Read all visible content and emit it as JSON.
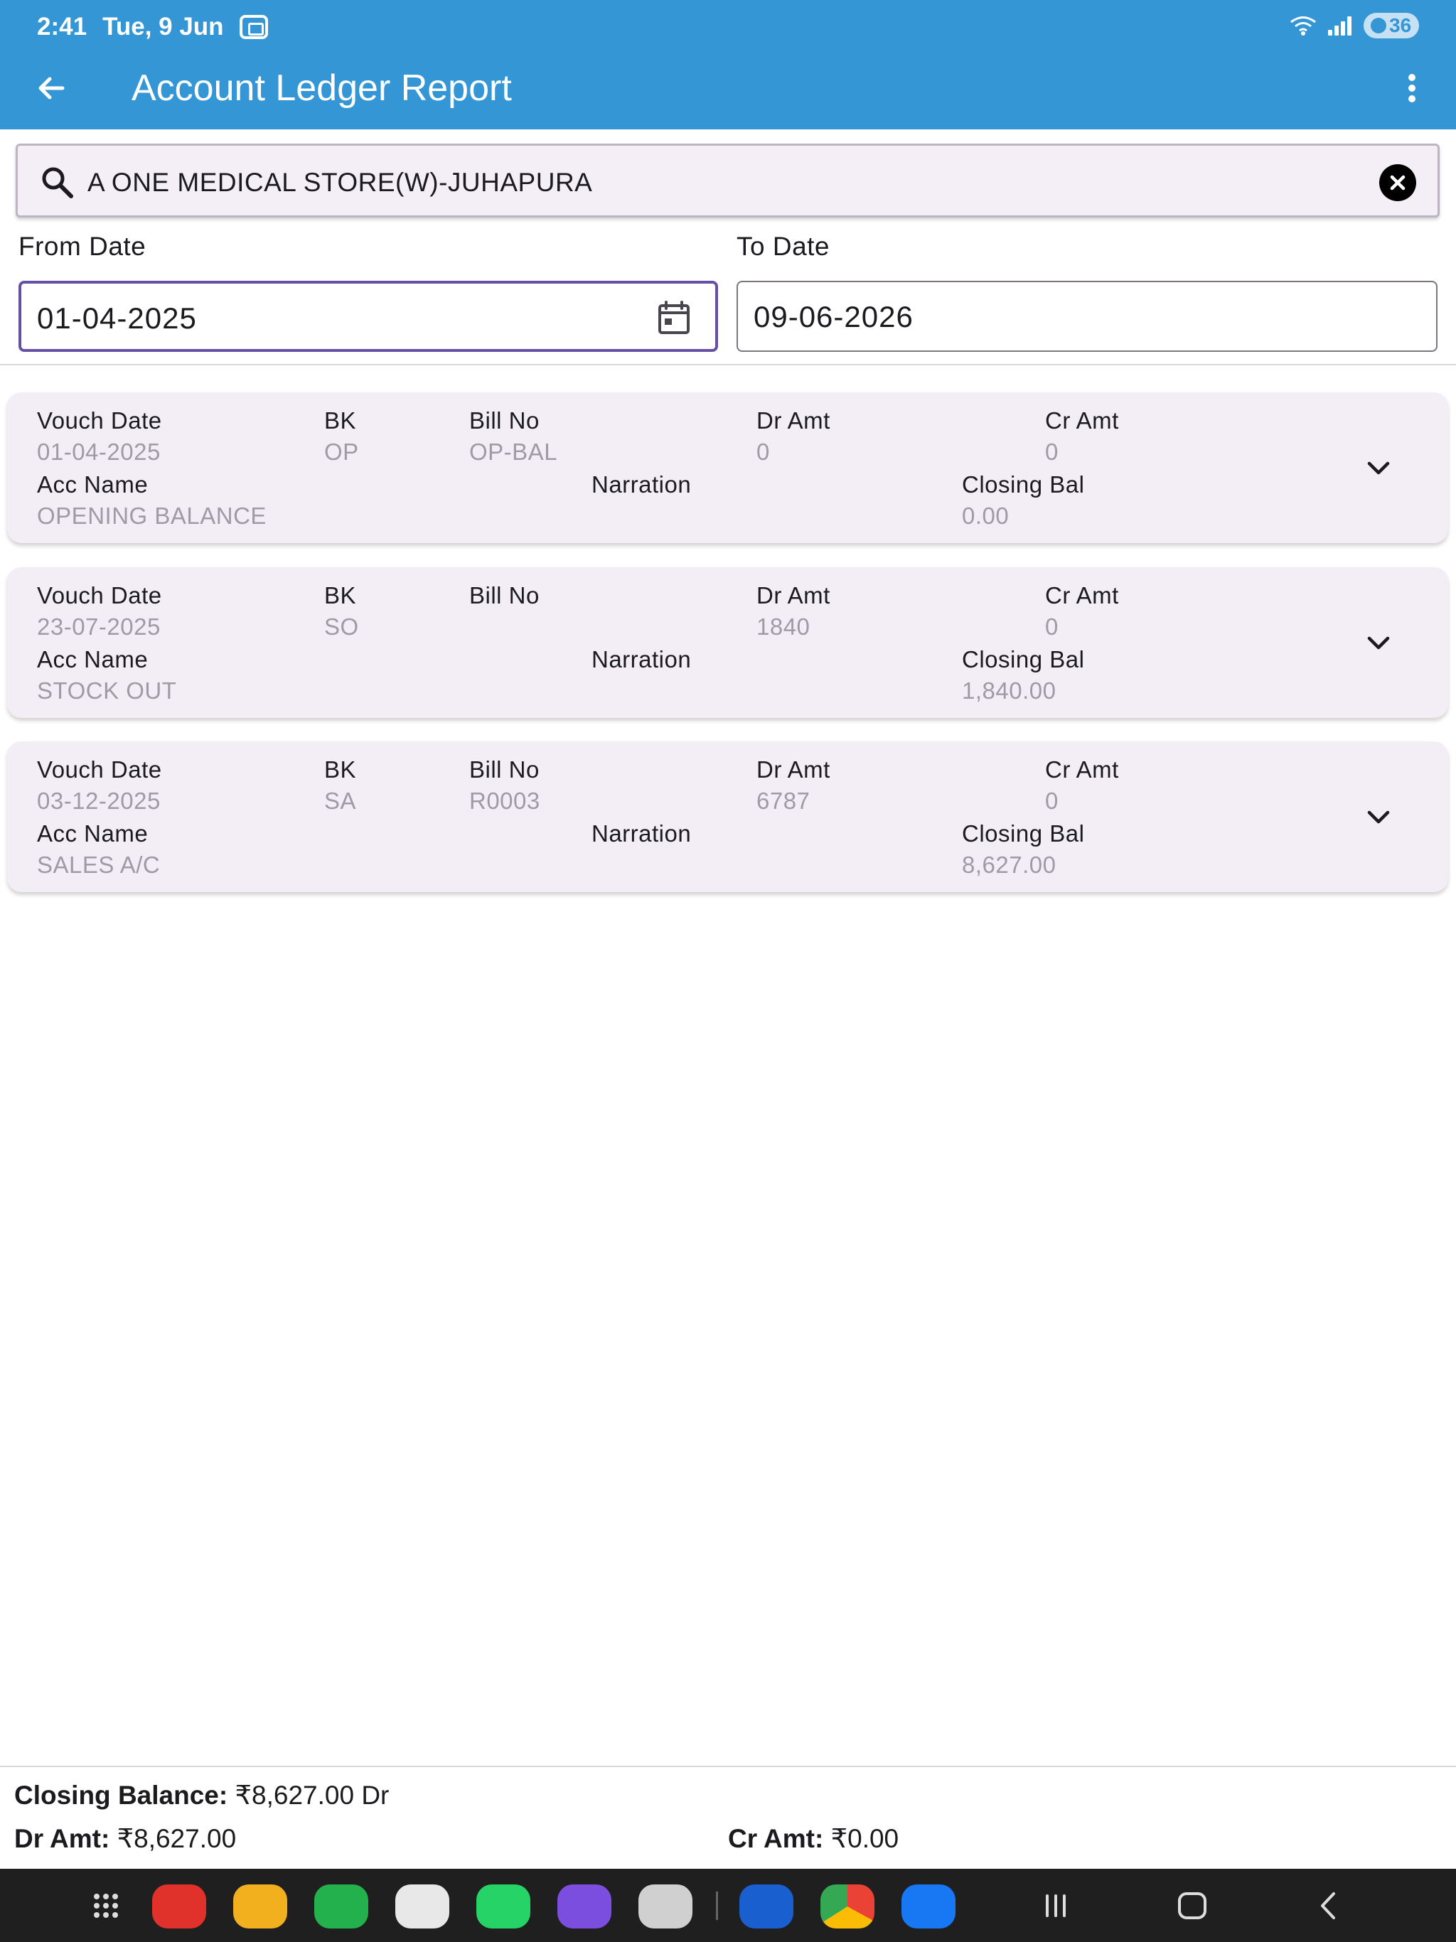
{
  "status_bar": {
    "time": "2:41",
    "date": "Tue, 9 Jun",
    "battery": "36"
  },
  "app_bar": {
    "title": "Account Ledger Report"
  },
  "search": {
    "value": "A ONE MEDICAL STORE(W)-JUHAPURA"
  },
  "dates": {
    "from_label": "From Date",
    "from_value": "01-04-2025",
    "to_label": "To Date",
    "to_value": "09-06-2026"
  },
  "labels": {
    "vouch_date": "Vouch Date",
    "bk": "BK",
    "bill_no": "Bill No",
    "dr_amt": "Dr Amt",
    "cr_amt": "Cr Amt",
    "acc_name": "Acc Name",
    "narration": "Narration",
    "closing_bal": "Closing Bal"
  },
  "entries": [
    {
      "vouch_date": "01-04-2025",
      "bk": "OP",
      "bill_no": "OP-BAL",
      "dr_amt": "0",
      "cr_amt": "0",
      "acc_name": "OPENING BALANCE",
      "narration": "",
      "closing_bal": "0.00"
    },
    {
      "vouch_date": "23-07-2025",
      "bk": "SO",
      "bill_no": "",
      "dr_amt": "1840",
      "cr_amt": "0",
      "acc_name": "STOCK OUT",
      "narration": "",
      "closing_bal": "1,840.00"
    },
    {
      "vouch_date": "03-12-2025",
      "bk": "SA",
      "bill_no": "R0003",
      "dr_amt": "6787",
      "cr_amt": "0",
      "acc_name": "SALES A/C",
      "narration": "",
      "closing_bal": "8,627.00"
    }
  ],
  "totals": {
    "closing_label": "Closing Balance:",
    "closing_value": "₹8,627.00 Dr",
    "dr_label": "Dr Amt:",
    "dr_value": "₹8,627.00",
    "cr_label": "Cr Amt:",
    "cr_value": "₹0.00"
  },
  "dock_apps": [
    "apps-grid-icon",
    "notes-app-icon",
    "files-app-icon",
    "phone-app-icon",
    "messages-app-icon",
    "whatsapp-app-icon",
    "internet-app-icon",
    "camera-app-icon",
    "app-store-icon",
    "chrome-app-icon",
    "facebook-app-icon"
  ],
  "colors": {
    "app_bar": "#3596d6",
    "card_bg": "#f3eef6",
    "focus_border": "#6750a4",
    "muted_value": "#a09aa5"
  }
}
